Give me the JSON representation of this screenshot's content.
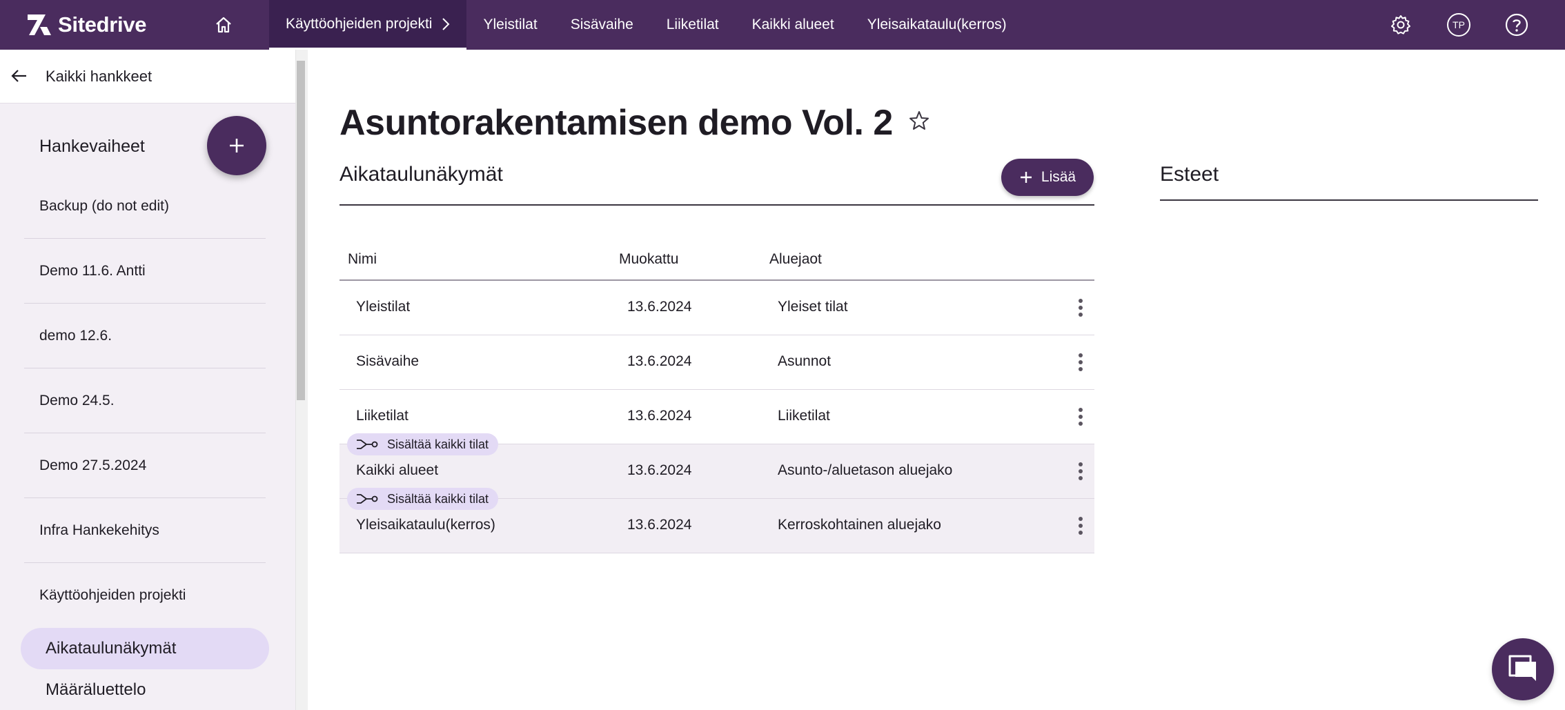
{
  "app": {
    "brand": "Sitedrive"
  },
  "topnav": {
    "items": [
      {
        "label": "Käyttöohjeiden projekti"
      },
      {
        "label": "Yleistilat"
      },
      {
        "label": "Sisävaihe"
      },
      {
        "label": "Liiketilat"
      },
      {
        "label": "Kaikki alueet"
      },
      {
        "label": "Yleisaikataulu(kerros)"
      }
    ],
    "active_index": 0,
    "avatar_initials": "TP",
    "icons": [
      "home-icon",
      "gear-icon",
      "help-icon"
    ]
  },
  "sidebar": {
    "back_label": "Kaikki hankkeet",
    "section_title": "Hankevaiheet",
    "projects": [
      {
        "label": "Backup (do not edit)"
      },
      {
        "label": "Demo 11.6. Antti"
      },
      {
        "label": "demo 12.6."
      },
      {
        "label": "Demo 24.5."
      },
      {
        "label": "Demo 27.5.2024"
      },
      {
        "label": "Infra Hankekehitys"
      },
      {
        "label": "Käyttöohjeiden projekti"
      }
    ],
    "subitems": [
      {
        "label": "Aikataulunäkymät",
        "active": true
      },
      {
        "label": "Määräluettelo",
        "active": false
      }
    ]
  },
  "main": {
    "title": "Asuntorakentamisen demo Vol. 2",
    "schedules": {
      "title": "Aikataulunäkymät",
      "add_label": "Lisää",
      "columns": [
        "Nimi",
        "Muokattu",
        "Aluejaot"
      ],
      "rows": [
        {
          "name": "Yleistilat",
          "modified": "13.6.2024",
          "areas": "Yleiset tilat",
          "tag": ""
        },
        {
          "name": "Sisävaihe",
          "modified": "13.6.2024",
          "areas": "Asunnot",
          "tag": ""
        },
        {
          "name": "Liiketilat",
          "modified": "13.6.2024",
          "areas": "Liiketilat",
          "tag": ""
        },
        {
          "name": "Kaikki alueet",
          "modified": "13.6.2024",
          "areas": "Asunto-/aluetason aluejako",
          "tag": "Sisältää kaikki tilat"
        },
        {
          "name": "Yleisaikataulu(kerros)",
          "modified": "13.6.2024",
          "areas": "Kerroskohtainen aluejako",
          "tag": "Sisältää kaikki tilat"
        }
      ]
    },
    "obstacles": {
      "title": "Esteet"
    }
  },
  "colors": {
    "brand": "#4a2c5e",
    "active_chip": "#e3daf5",
    "sidebar_bg": "#f3eff5"
  }
}
